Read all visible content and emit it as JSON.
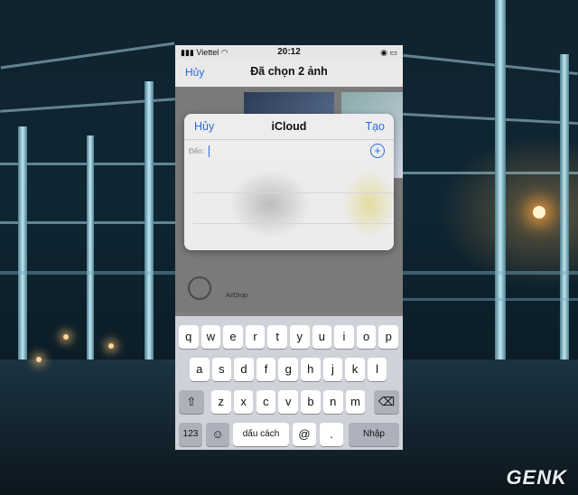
{
  "status_bar": {
    "carrier": "Viettel",
    "time": "20:12"
  },
  "share_sheet": {
    "cancel_label": "Hủy",
    "title": "Đã chọn 2 ảnh",
    "airdrop_label": "AirDrop:"
  },
  "icloud_dialog": {
    "cancel_label": "Hủy",
    "title": "iCloud",
    "create_label": "Tạo",
    "to_label": "Đến:",
    "add_icon": "plus-circle-icon"
  },
  "keyboard": {
    "row1": [
      "q",
      "w",
      "e",
      "r",
      "t",
      "y",
      "u",
      "i",
      "o",
      "p"
    ],
    "row2": [
      "a",
      "s",
      "d",
      "f",
      "g",
      "h",
      "j",
      "k",
      "l"
    ],
    "row3": [
      "z",
      "x",
      "c",
      "v",
      "b",
      "n",
      "m"
    ],
    "numbers_label": "123",
    "emoji_icon": "emoji-icon",
    "space_label": "dấu cách",
    "at_label": "@",
    "dot_label": ".",
    "return_label": "Nhập",
    "shift_icon": "shift-icon",
    "delete_icon": "delete-icon"
  },
  "watermark": "GENK",
  "colors": {
    "ios_blue": "#2a6ad6",
    "keyboard_bg": "#cfd2d8",
    "key_dark": "#acb1bb"
  }
}
